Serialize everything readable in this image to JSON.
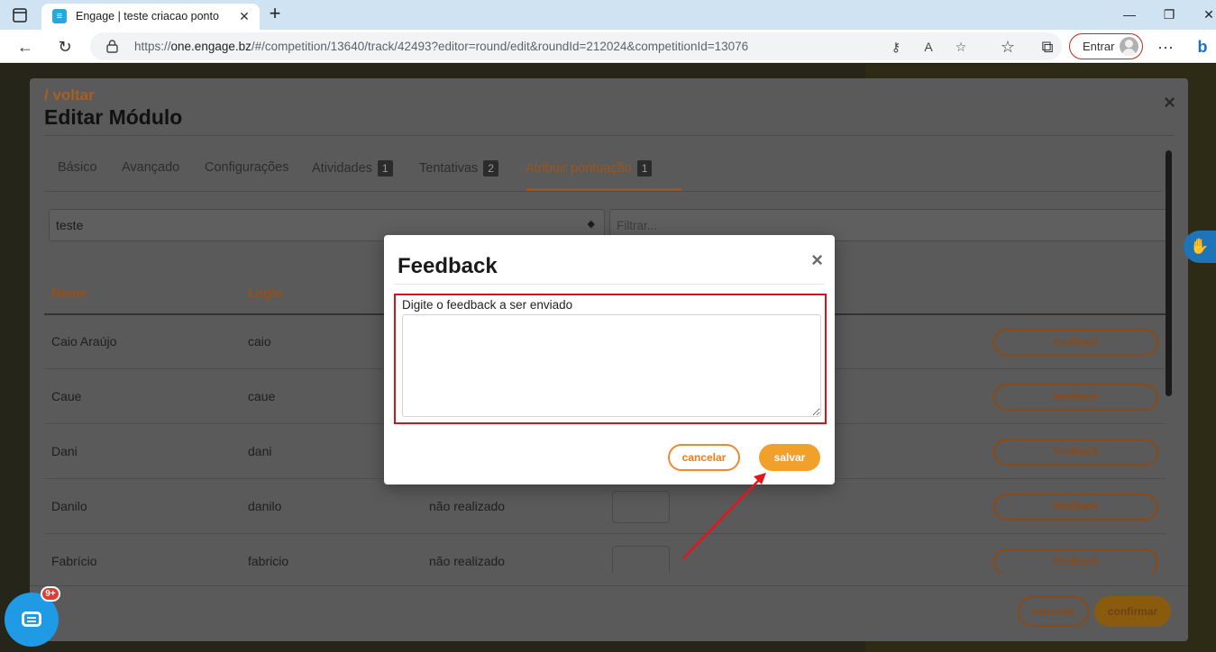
{
  "browser": {
    "tab_title": "Engage | teste criacao ponto",
    "url_prefix": "https://",
    "url_domain": "one.engage.bz",
    "url_path": "/#/competition/13640/track/42493?editor=round/edit&roundId=212024&competitionId=13076",
    "entrar_label": "Entrar"
  },
  "module": {
    "back_label": "/ voltar",
    "title": "Editar Módulo",
    "tabs": [
      {
        "label": "Básico",
        "badge": ""
      },
      {
        "label": "Avançado",
        "badge": ""
      },
      {
        "label": "Configurações",
        "badge": ""
      },
      {
        "label": "Atividades",
        "badge": "1"
      },
      {
        "label": "Tentativas",
        "badge": "2"
      },
      {
        "label": "Atribuir pontuação",
        "badge": "1"
      }
    ],
    "select_value": "teste",
    "filter_placeholder": "Filtrar...",
    "columns": [
      "Nome",
      "Login"
    ],
    "rows": [
      {
        "name": "Caio Araújo",
        "login": "caio",
        "status": "",
        "action": "feedback"
      },
      {
        "name": "Caue",
        "login": "caue",
        "status": "",
        "action": "feedback"
      },
      {
        "name": "Dani",
        "login": "dani",
        "status": "",
        "action": "feedback"
      },
      {
        "name": "Danilo",
        "login": "danilo",
        "status": "não realizado",
        "action": "feedback"
      },
      {
        "name": "Fabrício",
        "login": "fabricio",
        "status": "não realizado",
        "action": "feedback"
      }
    ],
    "cancel_label": "cancelar",
    "confirm_label": "confirmar"
  },
  "dialog": {
    "title": "Feedback",
    "field_label": "Digite o feedback a ser enviado",
    "field_value": "",
    "cancel_label": "cancelar",
    "save_label": "salvar"
  },
  "chat": {
    "badge": "9+"
  },
  "colors": {
    "accent": "#f1a12a",
    "highlight": "#d4141a"
  }
}
